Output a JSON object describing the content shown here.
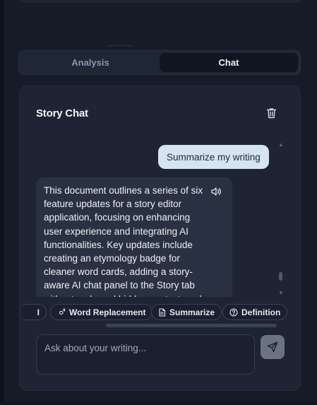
{
  "tabs": [
    {
      "label": "Analysis",
      "active": false
    },
    {
      "label": "Chat",
      "active": true
    }
  ],
  "chat": {
    "title": "Story Chat",
    "trash_icon": "trash-icon",
    "messages": {
      "user": "Summarize my writing",
      "assistant": "This document outlines a series of six feature updates for a story editor application, focusing on enhancing user experience and integrating AI functionalities. Key updates include creating an etymology badge for cleaner word cards, adding a story-aware AI chat panel to the Story tab with a toggle and hidden context, and"
    },
    "speak_icon": "speaker-icon",
    "chips": {
      "partial_label": "I",
      "word_replacement": "Word Replacement",
      "summarize": "Summarize",
      "definition": "Definition"
    },
    "input": {
      "placeholder": "Ask about your writing...",
      "value": ""
    },
    "send_icon": "send-icon"
  },
  "colors": {
    "background": "#161b27",
    "panel": "#1e2433",
    "user_bubble": "#d6e4f2",
    "assistant_bubble": "#2a3142",
    "active_tab": "#101521",
    "send_button": "#6b7380"
  }
}
